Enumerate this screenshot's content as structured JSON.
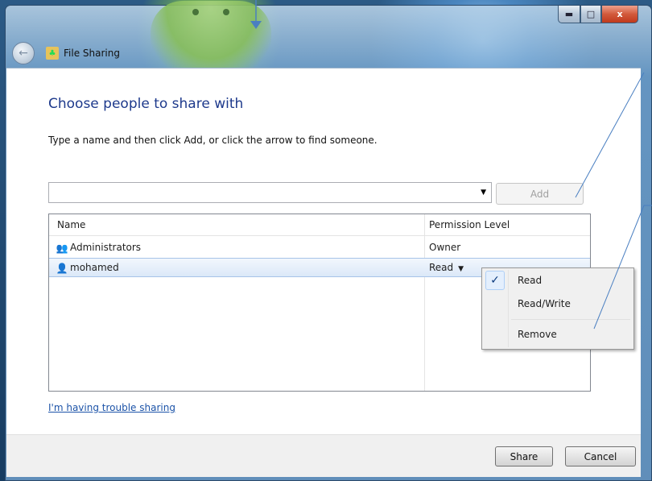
{
  "window": {
    "title": "File Sharing",
    "caption_buttons": {
      "minimize": "▬",
      "maximize": "□",
      "close": "x"
    }
  },
  "dialog": {
    "heading": "Choose people to share with",
    "instruction": "Type a name and then click Add, or click the arrow to find someone.",
    "name_input": {
      "value": "",
      "arrow_icon": "dropdown-arrow-icon"
    },
    "add_button_label": "Add",
    "list": {
      "columns": [
        "Name",
        "Permission Level"
      ],
      "rows": [
        {
          "name": "Administrators",
          "permission": "Owner",
          "icon": "group-icon"
        },
        {
          "name": "mohamed",
          "permission": "Read",
          "icon": "user-icon"
        }
      ]
    },
    "trouble_link": "I'm having trouble sharing",
    "share_button_label": "Share",
    "cancel_button_label": "Cancel"
  },
  "permission_menu": {
    "items": [
      {
        "label": "Read",
        "checked": true
      },
      {
        "label": "Read/Write",
        "checked": false
      },
      {
        "label": "Remove",
        "checked": false
      }
    ],
    "check_glyph": "✓"
  },
  "colors": {
    "heading": "#1e3a8c",
    "link": "#1c53a8",
    "selected_row": "#dbe8f8",
    "annotation": "#4a7fc1"
  }
}
